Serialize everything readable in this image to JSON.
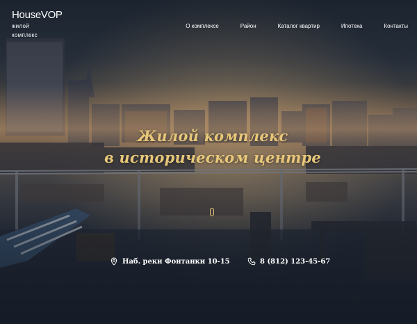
{
  "brand": {
    "name": "HouseVOP",
    "subtitle_line1": "жилой",
    "subtitle_line2": "комплекс"
  },
  "nav": [
    {
      "label": "О комплексе"
    },
    {
      "label": "Район"
    },
    {
      "label": "Каталог квартир"
    },
    {
      "label": "Ипотека"
    },
    {
      "label": "Контакты"
    }
  ],
  "hero": {
    "title_line1": "Жилой комплекс",
    "title_line2": "в историческом центре"
  },
  "contacts": {
    "address": "Наб. реки Фонтанки 10-15",
    "phone": "8 (812) 123-45-67"
  },
  "colors": {
    "accent": "#e7c77a",
    "text": "#ffffff",
    "background": "#1a2230"
  },
  "icons": {
    "address": "map-pin-icon",
    "phone": "phone-icon",
    "scroll": "scroll-down-icon"
  }
}
